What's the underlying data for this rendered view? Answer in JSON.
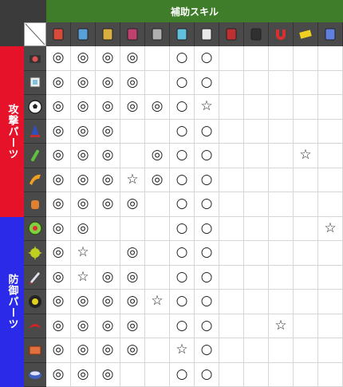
{
  "header": {
    "title": "補助スキル"
  },
  "groups": [
    {
      "label": "攻撃パーツ",
      "color": "#e6122a",
      "rows": 7
    },
    {
      "label": "防御パーツ",
      "color": "#2a2ae8",
      "rows": 7
    }
  ],
  "columns": [
    {
      "icon": "bottle-icon",
      "color": "#d84a3a"
    },
    {
      "icon": "spray-icon",
      "color": "#5aa0d8"
    },
    {
      "icon": "scroll-icon",
      "color": "#d8b040"
    },
    {
      "icon": "disc-icon",
      "color": "#c04070"
    },
    {
      "icon": "boot-icon",
      "color": "#b0b0b0"
    },
    {
      "icon": "map-icon",
      "color": "#60c0e0"
    },
    {
      "icon": "shoe-icon",
      "color": "#e8e8e8"
    },
    {
      "icon": "book-icon",
      "color": "#c03030"
    },
    {
      "icon": "bag-icon",
      "color": "#303030"
    },
    {
      "icon": "magnet-icon",
      "color": "#d83030"
    },
    {
      "icon": "ticket-icon",
      "color": "#f0d020"
    },
    {
      "icon": "can-icon",
      "color": "#6080e0"
    }
  ],
  "rows": [
    {
      "icon": "camera-icon",
      "color": "#e05050",
      "marks": [
        "◎",
        "◎",
        "◎",
        "◎",
        "",
        "○",
        "○",
        "",
        "",
        "",
        "",
        ""
      ]
    },
    {
      "icon": "cube-icon",
      "color": "#80c0e0",
      "marks": [
        "◎",
        "◎",
        "◎",
        "◎",
        "",
        "○",
        "○",
        "",
        "",
        "",
        "",
        ""
      ]
    },
    {
      "icon": "soccer-ball-icon",
      "color": "#ffffff",
      "marks": [
        "◎",
        "◎",
        "◎",
        "◎",
        "◎",
        "○",
        "☆",
        "",
        "",
        "",
        "",
        ""
      ]
    },
    {
      "icon": "cone-icon",
      "color": "#3050c0",
      "marks": [
        "◎",
        "◎",
        "◎",
        "",
        "",
        "○",
        "○",
        "",
        "",
        "",
        "",
        ""
      ]
    },
    {
      "icon": "stick-icon",
      "color": "#60c040",
      "marks": [
        "◎",
        "◎",
        "◎",
        "",
        "◎",
        "○",
        "○",
        "",
        "",
        "",
        "☆",
        ""
      ]
    },
    {
      "icon": "horn-icon",
      "color": "#f0a020",
      "marks": [
        "◎",
        "◎",
        "◎",
        "☆",
        "◎",
        "○",
        "○",
        "",
        "",
        "",
        "",
        ""
      ]
    },
    {
      "icon": "hand-icon",
      "color": "#e08030",
      "marks": [
        "◎",
        "◎",
        "◎",
        "◎",
        "",
        "○",
        "○",
        "",
        "",
        "",
        "",
        ""
      ]
    },
    {
      "icon": "shield-icon",
      "color": "#80d040",
      "marks": [
        "◎",
        "◎",
        "",
        "",
        "",
        "○",
        "○",
        "",
        "",
        "",
        "",
        "☆"
      ]
    },
    {
      "icon": "spiky-ball-icon",
      "color": "#c0d020",
      "marks": [
        "◎",
        "☆",
        "",
        "◎",
        "",
        "○",
        "○",
        "",
        "",
        "",
        "",
        ""
      ]
    },
    {
      "icon": "rocket-icon",
      "color": "#e0e0f0",
      "marks": [
        "◎",
        "☆",
        "◎",
        "◎",
        "",
        "○",
        "○",
        "",
        "",
        "",
        "",
        ""
      ]
    },
    {
      "icon": "tire-icon",
      "color": "#e0d020",
      "marks": [
        "◎",
        "◎",
        "◎",
        "◎",
        "☆",
        "○",
        "○",
        "",
        "",
        "",
        "",
        ""
      ]
    },
    {
      "icon": "boomerang-icon",
      "color": "#e02020",
      "marks": [
        "◎",
        "◎",
        "◎",
        "◎",
        "",
        "○",
        "○",
        "",
        "",
        "☆",
        "",
        ""
      ]
    },
    {
      "icon": "brick-icon",
      "color": "#e07040",
      "marks": [
        "◎",
        "◎",
        "◎",
        "◎",
        "",
        "☆",
        "○",
        "",
        "",
        "",
        "",
        ""
      ]
    },
    {
      "icon": "bowl-icon",
      "color": "#4060c0",
      "marks": [
        "◎",
        "◎",
        "◎",
        "",
        "",
        "○",
        "○",
        "",
        "",
        "",
        "",
        ""
      ]
    }
  ]
}
